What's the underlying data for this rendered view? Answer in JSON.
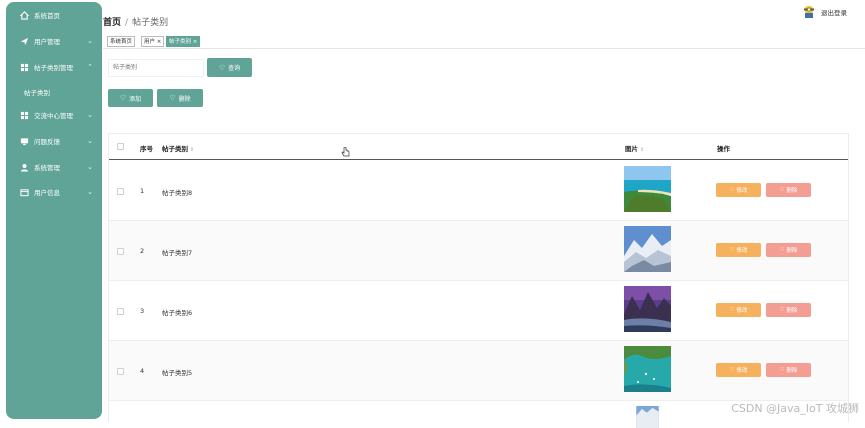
{
  "sidebar": {
    "bg": "#5fa497",
    "items": [
      {
        "label": "系统首页",
        "icon": "home-icon"
      },
      {
        "label": "用户管理",
        "icon": "send-icon"
      },
      {
        "label": "帖子类别管理",
        "icon": "grid-icon",
        "expanded": true
      },
      {
        "label": "交流中心管理",
        "icon": "grid-icon"
      },
      {
        "label": "问题反馈",
        "icon": "monitor-icon"
      },
      {
        "label": "系统管理",
        "icon": "user-icon"
      },
      {
        "label": "用户信息",
        "icon": "card-icon"
      }
    ],
    "sub_item": "帖子类别"
  },
  "header": {
    "home": "首页",
    "separator": "/",
    "current": "帖子类别",
    "logout": "退出登录"
  },
  "tags": [
    {
      "label": "系统首页",
      "active": false
    },
    {
      "label": "用户 ×",
      "active": false
    },
    {
      "label": "帖子类别 ×",
      "active": true
    }
  ],
  "search": {
    "placeholder": "帖子类别",
    "button": "查询"
  },
  "toolbar": {
    "add": "添加",
    "delete": "删除"
  },
  "table": {
    "columns": [
      "序号",
      "帖子类别",
      "图片",
      "操作"
    ],
    "rows": [
      {
        "no": "1",
        "name": "帖子类别8",
        "image": "beach-photo"
      },
      {
        "no": "2",
        "name": "帖子类别7",
        "image": "snow-mountain-photo"
      },
      {
        "no": "3",
        "name": "帖子类别6",
        "image": "mountain-sunset-photo"
      },
      {
        "no": "4",
        "name": "帖子类别5",
        "image": "bay-photo"
      }
    ],
    "edit_label": "修改",
    "delete_label": "删除"
  },
  "watermark": "CSDN @Java_IoT 攻城狮",
  "colors": {
    "accent": "#5fa497",
    "edit": "#f6b15f",
    "delete": "#f49d92"
  }
}
